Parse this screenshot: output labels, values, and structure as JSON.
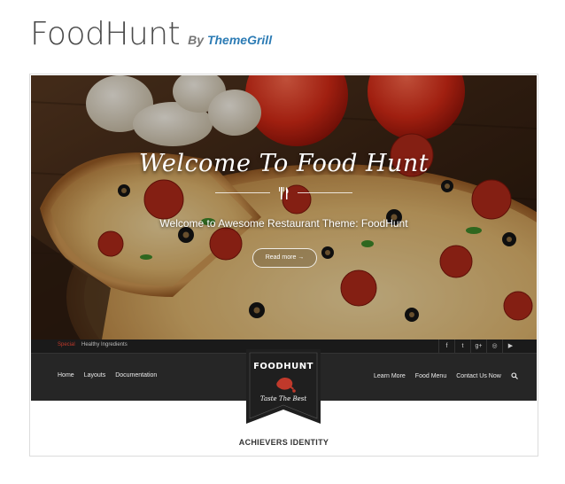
{
  "header": {
    "title": "FoodHunt",
    "by": "By",
    "author": "ThemeGrill"
  },
  "hero": {
    "title": "Welcome To Food Hunt",
    "subtitle": "Welcome to Awesome Restaurant Theme: FoodHunt",
    "button_label": "Read more →"
  },
  "topbar": {
    "special_label": "Special",
    "news_text": "Healthy Ingredients",
    "social": [
      "f",
      "t",
      "g+",
      "◎",
      "▶"
    ]
  },
  "nav": {
    "left": [
      "Home",
      "Layouts",
      "Documentation"
    ],
    "right": [
      "Learn More",
      "Food Menu",
      "Contact Us Now"
    ]
  },
  "logo": {
    "name": "FOODHUNT",
    "tagline": "Taste The Best"
  },
  "section": {
    "title": "ACHIEVERS IDENTITY"
  },
  "colors": {
    "accent": "#c0392b",
    "author_link": "#2d7cb5",
    "nav_bg": "#262626",
    "topbar_bg": "#1a1a1a"
  }
}
